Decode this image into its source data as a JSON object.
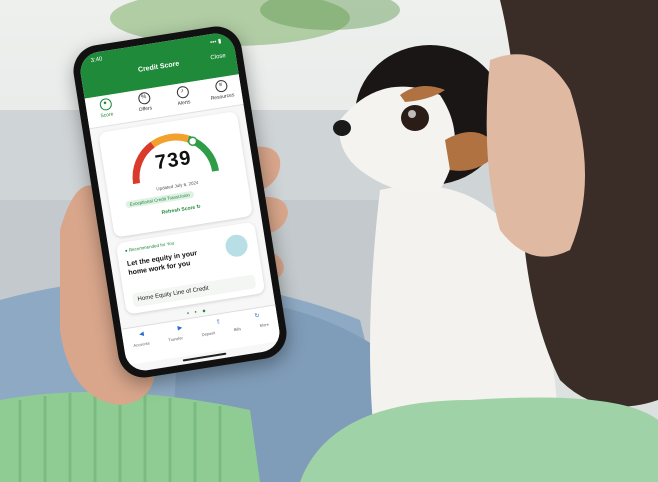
{
  "phone": {
    "time": "3:40",
    "signal": "••• ▮",
    "title": "Credit Score",
    "close_label": "Close",
    "tabs": [
      {
        "label": "Score",
        "icon": "score-icon",
        "glyph": "●"
      },
      {
        "label": "Offers",
        "icon": "offers-icon",
        "glyph": "%"
      },
      {
        "label": "Alerts",
        "icon": "bell-icon",
        "glyph": "♪"
      },
      {
        "label": "Resources",
        "icon": "resources-icon",
        "glyph": "≡"
      }
    ],
    "score": "739",
    "score_min": "300",
    "score_max": "850",
    "updated": "Updated July 6, 2024",
    "pill": "Exceptional Credit  TransUnion",
    "refresh": "Refresh Score ↻",
    "promo": {
      "tag": "● Recommended for You",
      "headline": "Let the equity in your home work for you",
      "line": "Home Equity Line of Credit"
    },
    "dots": "• • ●",
    "nav_arrows": [
      "◀",
      "▶",
      "⇧",
      "↻"
    ],
    "nav_labels": [
      "Accounts",
      "Transfer",
      "Deposit",
      "Bills",
      "More"
    ]
  },
  "colors": {
    "brand_green": "#1f8a3a",
    "gauge_red": "#d93a2b",
    "gauge_orange": "#f2a12c",
    "gauge_green": "#2f9d48"
  }
}
